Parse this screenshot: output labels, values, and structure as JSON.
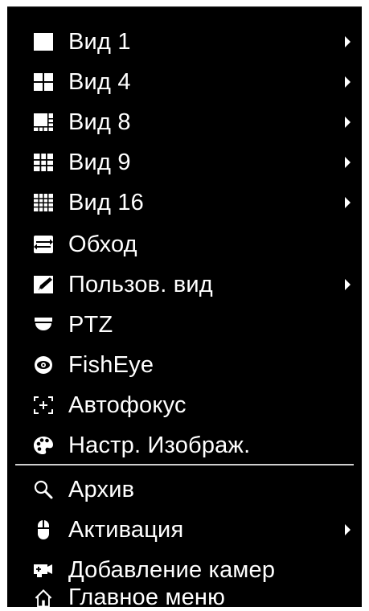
{
  "menu": {
    "items": [
      {
        "label": "Вид 1",
        "icon": "view-1-icon",
        "submenu": true
      },
      {
        "label": "Вид 4",
        "icon": "view-4-icon",
        "submenu": true
      },
      {
        "label": "Вид 8",
        "icon": "view-8-icon",
        "submenu": true
      },
      {
        "label": "Вид 9",
        "icon": "view-9-icon",
        "submenu": true
      },
      {
        "label": "Вид 16",
        "icon": "view-16-icon",
        "submenu": true
      },
      {
        "label": "Обход",
        "icon": "tour-icon",
        "submenu": false
      },
      {
        "label": "Пользов. вид",
        "icon": "custom-view-icon",
        "submenu": true
      },
      {
        "label": "PTZ",
        "icon": "ptz-icon",
        "submenu": false
      },
      {
        "label": "FishEye",
        "icon": "fisheye-icon",
        "submenu": false
      },
      {
        "label": "Автофокус",
        "icon": "autofocus-icon",
        "submenu": false
      },
      {
        "label": "Настр. Изображ.",
        "icon": "palette-icon",
        "submenu": false
      },
      {
        "label": "Архив",
        "icon": "search-icon",
        "submenu": false
      },
      {
        "label": "Активация",
        "icon": "mouse-icon",
        "submenu": true
      },
      {
        "label": "Добавление камер",
        "icon": "add-camera-icon",
        "submenu": false
      },
      {
        "label": "Главное меню",
        "icon": "home-icon",
        "submenu": false
      }
    ]
  },
  "colors": {
    "background": "#000000",
    "text": "#ffffff",
    "separator": "#cfcfcf"
  }
}
